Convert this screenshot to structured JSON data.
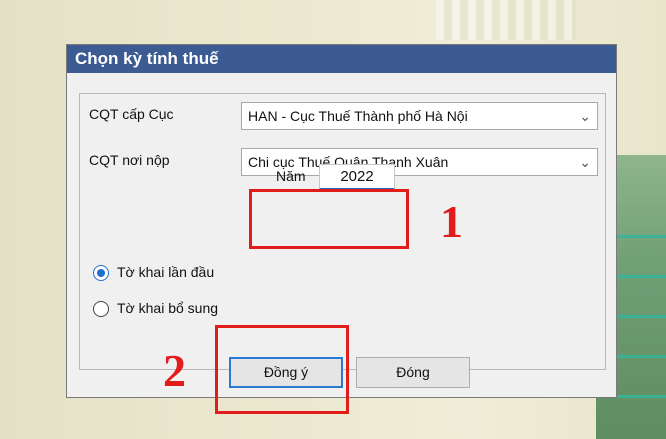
{
  "dialog": {
    "title": "Chọn kỳ tính thuế",
    "cqt_cap_cuc_label": "CQT cấp Cục",
    "cqt_cap_cuc_value": "HAN - Cục Thuế Thành phố Hà Nội",
    "cqt_noi_nop_label": "CQT nơi nộp",
    "cqt_noi_nop_value": "Chi cục Thuế Quận Thanh Xuân",
    "year_label": "Năm",
    "year_value": "2022",
    "radio_first": "Tờ khai lần đầu",
    "radio_supplement": "Tờ khai bổ sung",
    "radio_selected": "Tờ khai lần đầu",
    "ok_button_prefix": "Đồn",
    "ok_button_access": "g",
    "ok_button_suffix": " ý",
    "close_button_prefix": "Đón",
    "close_button_access": "g",
    "close_button_suffix": ""
  },
  "annotations": {
    "step1": "1",
    "step2": "2"
  },
  "icons": {
    "dropdown": "chevron-down-icon"
  },
  "colors": {
    "title_bar": "#3d5b93",
    "highlight": "#e21b1b",
    "radio_accent": "#1e6fd0"
  }
}
